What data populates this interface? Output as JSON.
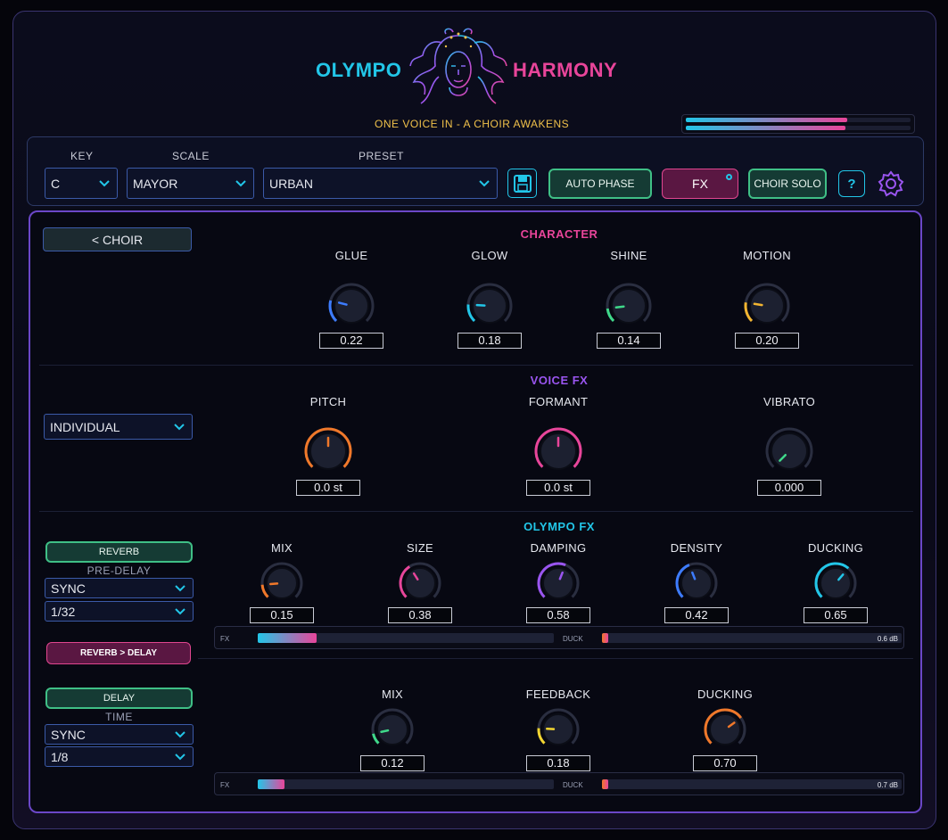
{
  "header": {
    "title_left": "OLYMPO",
    "title_right": "HARMONY",
    "tagline": "ONE VOICE IN - A CHOIR AWAKENS",
    "output_levels": [
      0.72,
      0.71
    ]
  },
  "topbar": {
    "key_label": "KEY",
    "key_value": "C",
    "scale_label": "SCALE",
    "scale_value": "MAYOR",
    "preset_label": "PRESET",
    "preset_value": "URBAN",
    "auto_phase": "AUTO PHASE",
    "fx": "FX",
    "choir_solo": "CHOIR SOLO",
    "help": "?"
  },
  "sidebar": {
    "back": "<  CHOIR",
    "mode_value": "INDIVIDUAL",
    "reverb": "REVERB",
    "predelay_label": "PRE-DELAY",
    "predelay_mode": "SYNC",
    "predelay_value": "1/32",
    "routing": "REVERB > DELAY",
    "delay": "DELAY",
    "time_label": "TIME",
    "time_mode": "SYNC",
    "time_value": "1/8"
  },
  "character": {
    "title": "CHARACTER",
    "knobs": [
      {
        "label": "GLUE",
        "value": "0.22",
        "level": 0.22,
        "color": "#3d7cff"
      },
      {
        "label": "GLOW",
        "value": "0.18",
        "level": 0.18,
        "color": "#22c6e8"
      },
      {
        "label": "SHINE",
        "value": "0.14",
        "level": 0.14,
        "color": "#3fd98a"
      },
      {
        "label": "MOTION",
        "value": "0.20",
        "level": 0.2,
        "color": "#f2b531"
      }
    ]
  },
  "voice_fx": {
    "title": "VOICE FX",
    "knobs": [
      {
        "label": "PITCH",
        "value": "0.0 st",
        "level": 0.5,
        "color": "#f0782a"
      },
      {
        "label": "FORMANT",
        "value": "0.0 st",
        "level": 0.5,
        "color": "#e8459a"
      },
      {
        "label": "VIBRATO",
        "value": "0.000",
        "level": 0.0,
        "color": "#3fd98a"
      }
    ]
  },
  "olympo_fx": {
    "title": "OLYMPO FX",
    "knobs": [
      {
        "label": "MIX",
        "value": "0.15",
        "level": 0.15,
        "color": "#f0782a"
      },
      {
        "label": "SIZE",
        "value": "0.38",
        "level": 0.38,
        "color": "#e8459a"
      },
      {
        "label": "DAMPING",
        "value": "0.58",
        "level": 0.58,
        "color": "#9a55f0"
      },
      {
        "label": "DENSITY",
        "value": "0.42",
        "level": 0.42,
        "color": "#3d7cff"
      },
      {
        "label": "DUCKING",
        "value": "0.65",
        "level": 0.65,
        "color": "#22c6e8"
      }
    ],
    "meter": {
      "fx_label": "FX",
      "duck_label": "DUCK",
      "fx_level": 0.2,
      "duck_value": "0.6 dB"
    }
  },
  "delay_fx": {
    "knobs": [
      {
        "label": "MIX",
        "value": "0.12",
        "level": 0.12,
        "color": "#3fd98a"
      },
      {
        "label": "FEEDBACK",
        "value": "0.18",
        "level": 0.18,
        "color": "#f2d531"
      },
      {
        "label": "DUCKING",
        "value": "0.70",
        "level": 0.7,
        "color": "#f0782a"
      }
    ],
    "meter": {
      "fx_label": "FX",
      "duck_label": "DUCK",
      "fx_level": 0.09,
      "duck_value": "0.7 dB"
    }
  },
  "colors": {
    "accent_pink": "#e8459a",
    "accent_cyan": "#22c6e8",
    "accent_purple": "#9a55f0"
  }
}
